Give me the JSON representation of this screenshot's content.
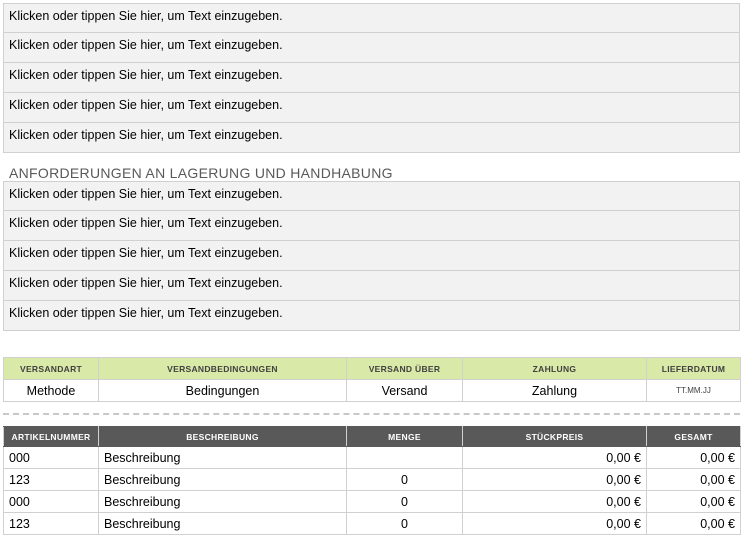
{
  "placeholder_text": "Klicken oder tippen Sie hier, um Text einzugeben.",
  "block1": [
    "Klicken oder tippen Sie hier, um Text einzugeben.",
    "Klicken oder tippen Sie hier, um Text einzugeben.",
    "Klicken oder tippen Sie hier, um Text einzugeben.",
    "Klicken oder tippen Sie hier, um Text einzugeben.",
    "Klicken oder tippen Sie hier, um Text einzugeben."
  ],
  "storage_heading": "ANFORDERUNGEN AN LAGERUNG UND HANDHABUNG",
  "block2": [
    "Klicken oder tippen Sie hier, um Text einzugeben.",
    "Klicken oder tippen Sie hier, um Text einzugeben.",
    "Klicken oder tippen Sie hier, um Text einzugeben.",
    "Klicken oder tippen Sie hier, um Text einzugeben.",
    "Klicken oder tippen Sie hier, um Text einzugeben."
  ],
  "shipping": {
    "headers": [
      "VERSANDART",
      "VERSANDBEDINGUNGEN",
      "VERSAND ÜBER",
      "ZAHLUNG",
      "LIEFERDATUM"
    ],
    "values": [
      "Methode",
      "Bedingungen",
      "Versand",
      "Zahlung",
      "TT.MM.JJ"
    ]
  },
  "items": {
    "headers": [
      "ARTIKELNUMMER",
      "BESCHREIBUNG",
      "MENGE",
      "STÜCKPREIS",
      "GESAMT"
    ],
    "rows": [
      [
        "000",
        "Beschreibung",
        "",
        "0,00 €",
        "0,00 €"
      ],
      [
        "123",
        "Beschreibung",
        "0",
        "0,00 €",
        "0,00 €"
      ],
      [
        "000",
        "Beschreibung",
        "0",
        "0,00 €",
        "0,00 €"
      ],
      [
        "123",
        "Beschreibung",
        "0",
        "0,00 €",
        "0,00 €"
      ]
    ]
  },
  "colors": {
    "shipping_header_bg": "#d8e9a8",
    "items_header_bg": "#595959",
    "field_bg": "#f2f2f2"
  }
}
